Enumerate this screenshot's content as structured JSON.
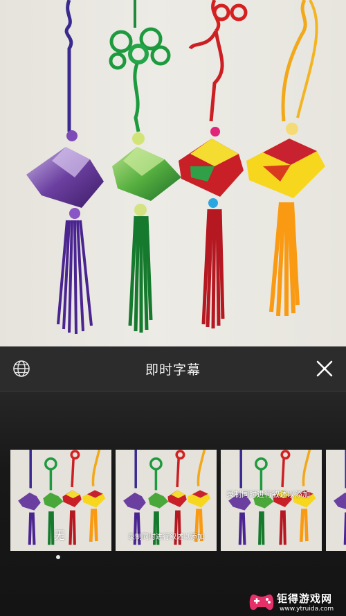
{
  "header": {
    "title": "即时字幕",
    "left_icon": "globe-icon",
    "right_icon": "close-icon"
  },
  "styles": [
    {
      "caption": "无",
      "caption_position": "center",
      "selected": true
    },
    {
      "caption": "录制同时进行叙述以添加",
      "caption_position": "bottom",
      "selected": false
    },
    {
      "caption": "录制同时进行叙述以添加",
      "caption_position": "top",
      "selected": false
    }
  ],
  "pager": {
    "active_index": 0
  },
  "watermark": {
    "name": "钜得游戏网",
    "url": "www.ytruida.com"
  },
  "colors": {
    "bar_bg": "#2c2c2c",
    "purple": "#5a2d8c",
    "green": "#2f9a3c",
    "red": "#c8202a",
    "yellow": "#f2c816",
    "orange": "#f7a21a"
  }
}
